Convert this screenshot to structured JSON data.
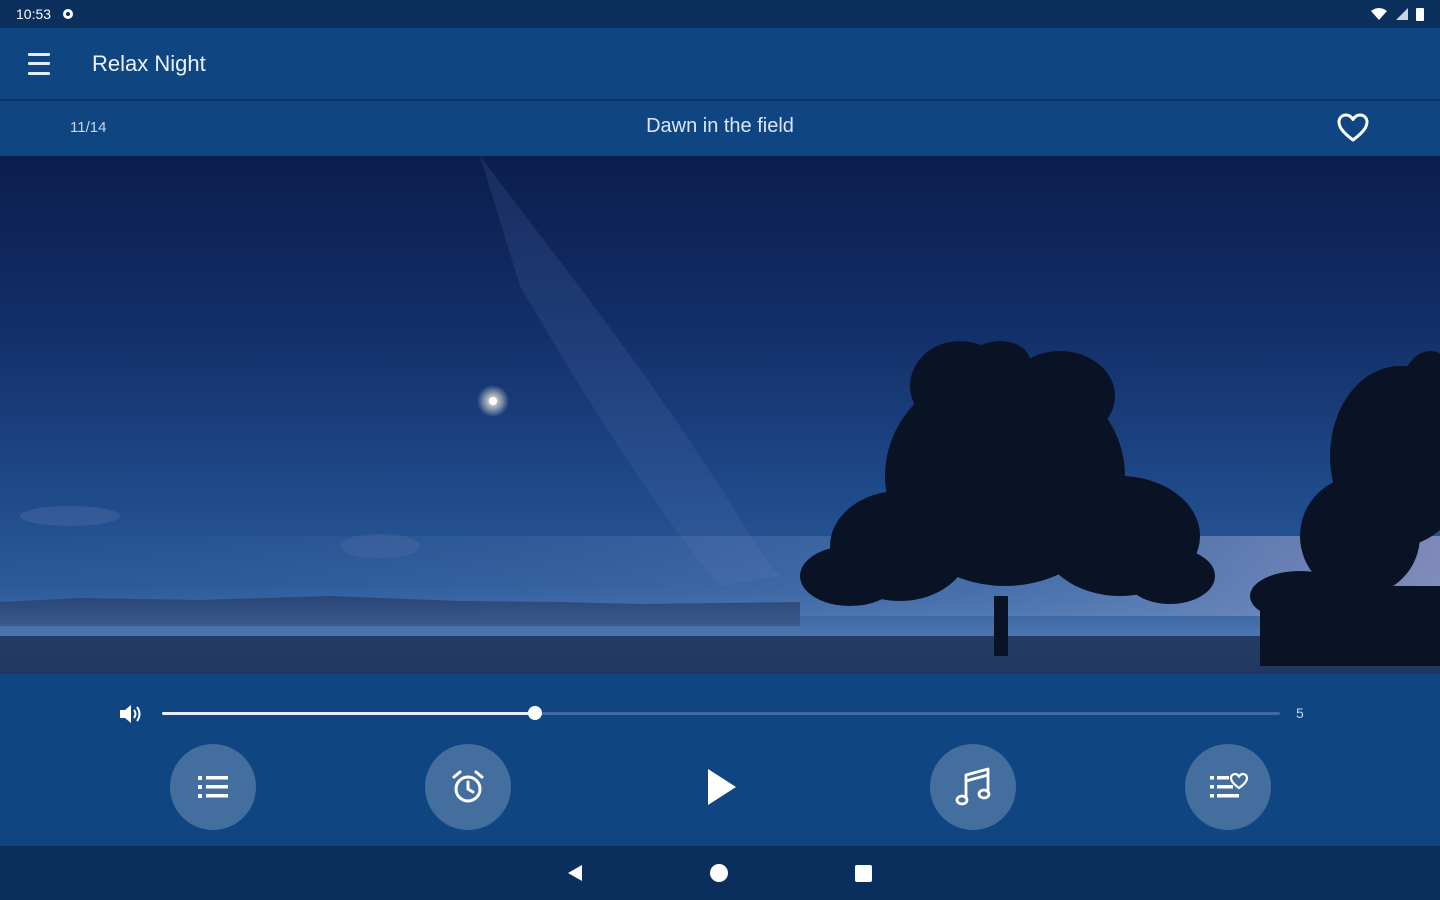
{
  "status_bar": {
    "time": "10:53",
    "icons": [
      "settings-icon",
      "wifi-icon",
      "signal-icon",
      "battery-icon"
    ]
  },
  "app_bar": {
    "title": "Relax Night",
    "menu_icon": "hamburger-menu-icon"
  },
  "track": {
    "index": "11/14",
    "title": "Dawn in the field",
    "favorite_icon": "heart-outline-icon"
  },
  "player": {
    "volume_icon": "volume-icon",
    "volume_level_fraction": 0.334,
    "volume_value": "5",
    "buttons": [
      {
        "name": "playlist-button",
        "icon": "list-icon"
      },
      {
        "name": "timer-button",
        "icon": "alarm-clock-icon"
      },
      {
        "name": "play-button",
        "icon": "play-icon"
      },
      {
        "name": "music-button",
        "icon": "music-note-icon"
      },
      {
        "name": "favorites-list-button",
        "icon": "favorite-list-icon"
      }
    ]
  },
  "navigation": {
    "back_icon": "back-triangle-icon",
    "home_icon": "home-circle-icon",
    "recent_icon": "recent-square-icon"
  },
  "colors": {
    "app_bar": "#0f4682",
    "status_bar": "#0b2f5c",
    "accent": "#ffffff"
  }
}
